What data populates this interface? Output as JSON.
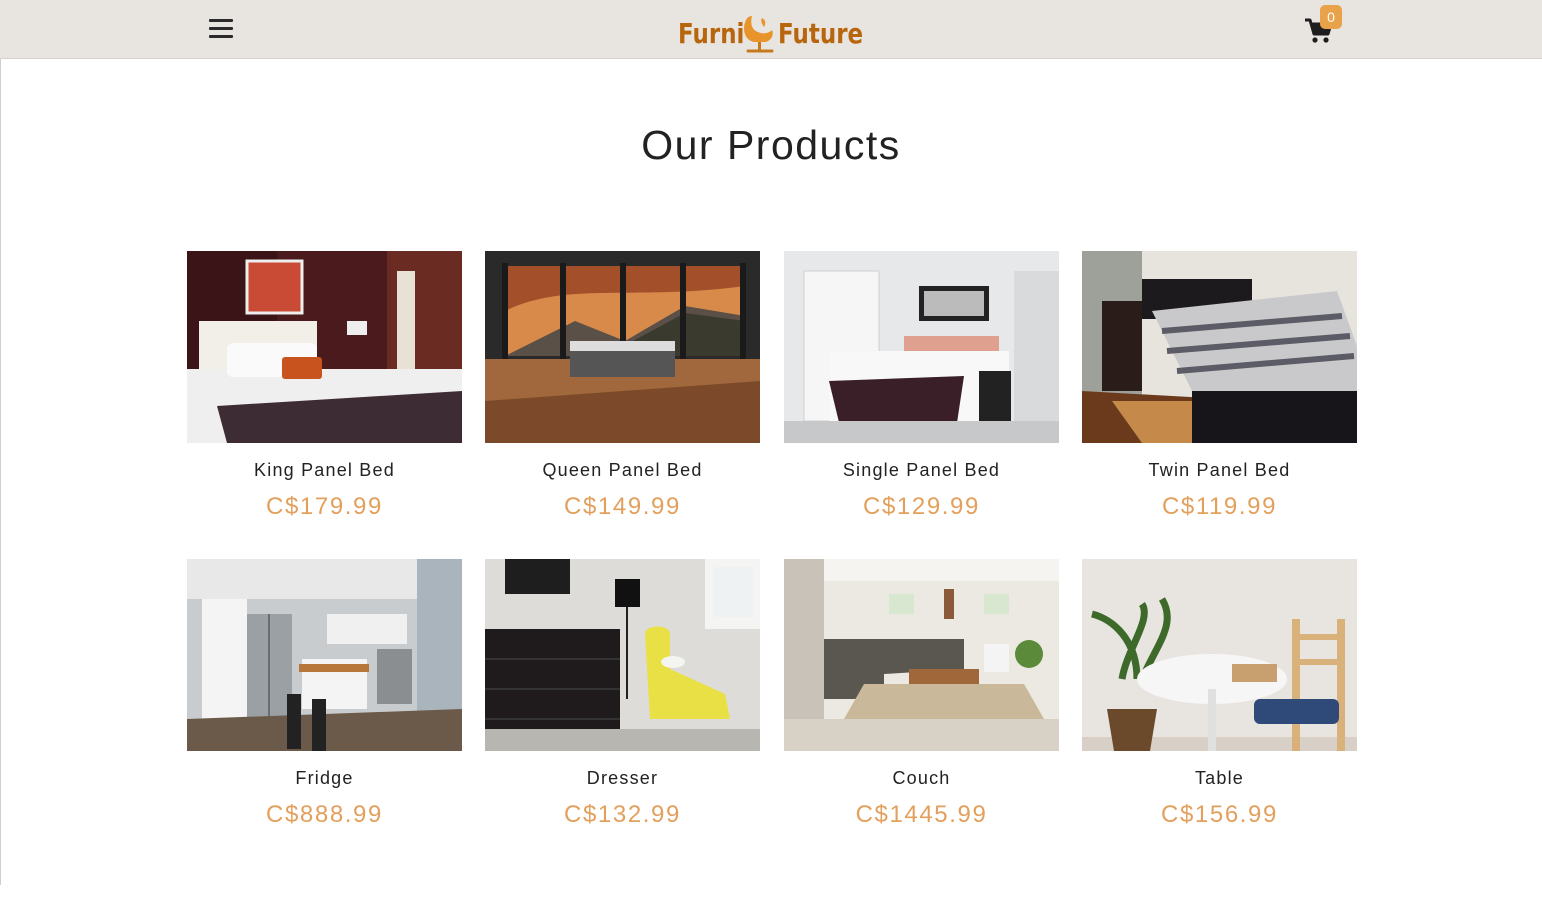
{
  "header": {
    "brand_left": "Furni",
    "brand_right": "Future",
    "cart_count": "0",
    "brand_color": "#b8660e",
    "accent_color": "#e8a24a"
  },
  "main": {
    "title": "Our Products"
  },
  "products": [
    {
      "name": "King Panel Bed",
      "price": "C$179.99"
    },
    {
      "name": "Queen Panel Bed",
      "price": "C$149.99"
    },
    {
      "name": "Single Panel Bed",
      "price": "C$129.99"
    },
    {
      "name": "Twin Panel Bed",
      "price": "C$119.99"
    },
    {
      "name": "Fridge",
      "price": "C$888.99"
    },
    {
      "name": "Dresser",
      "price": "C$132.99"
    },
    {
      "name": "Couch",
      "price": "C$1445.99"
    },
    {
      "name": "Table",
      "price": "C$156.99"
    }
  ],
  "icons": {
    "menu": "hamburger-menu-icon",
    "logo_mark": "egg-chair-icon",
    "cart": "shopping-cart-icon"
  },
  "price_color": "#e39f5c"
}
